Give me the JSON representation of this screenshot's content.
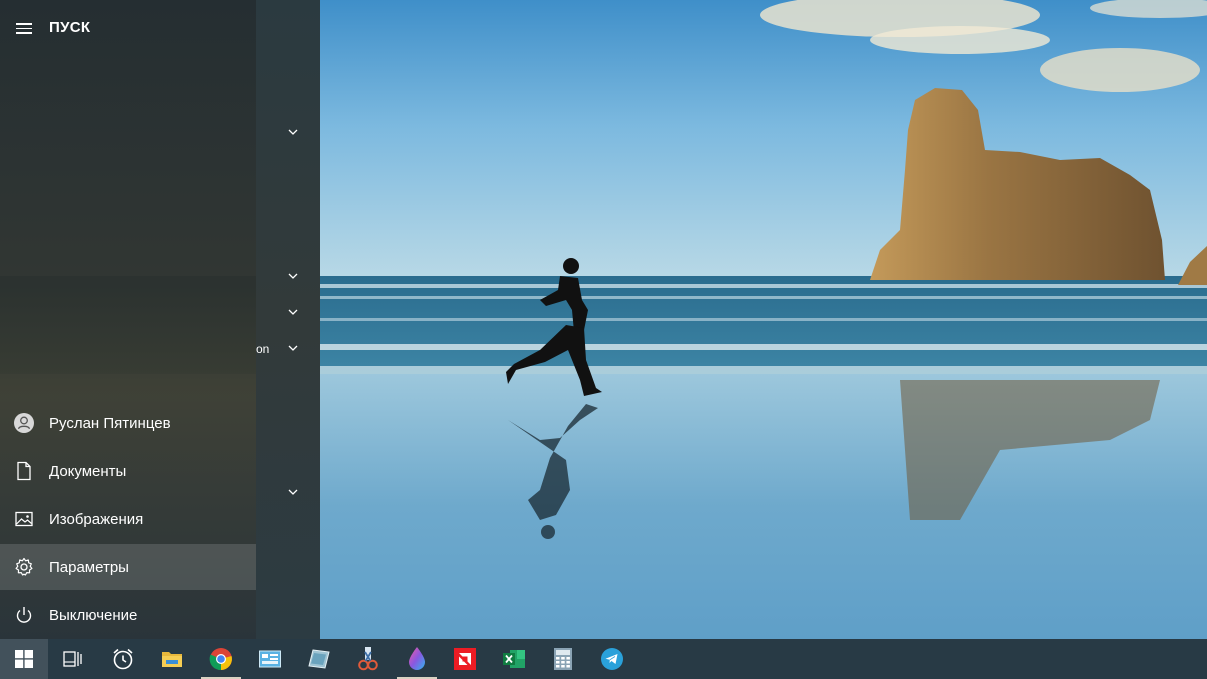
{
  "start_menu": {
    "title": "ПУСК",
    "rail_items": [
      {
        "label": "Руслан Пятинцев",
        "icon": "user-avatar-icon"
      },
      {
        "label": "Документы",
        "icon": "document-icon"
      },
      {
        "label": "Изображения",
        "icon": "pictures-icon"
      },
      {
        "label": "Параметры",
        "icon": "gear-icon",
        "active": true
      },
      {
        "label": "Выключение",
        "icon": "power-icon"
      }
    ],
    "app_list": {
      "partial_label": "on",
      "group_chevrons": [
        "chevron-down-icon",
        "chevron-down-icon",
        "chevron-down-icon",
        "chevron-down-icon",
        "chevron-down-icon"
      ]
    }
  },
  "taskbar": {
    "buttons": [
      {
        "name": "start-button",
        "icon": "windows-logo-icon"
      },
      {
        "name": "task-view-button",
        "icon": "task-view-icon"
      },
      {
        "name": "alarms-clock-button",
        "icon": "alarm-clock-icon"
      },
      {
        "name": "file-explorer-button",
        "icon": "folder-icon"
      },
      {
        "name": "chrome-button",
        "icon": "chrome-icon",
        "running": true
      },
      {
        "name": "control-panel-button",
        "icon": "control-panel-icon"
      },
      {
        "name": "app-tablet-button",
        "icon": "tablet-icon"
      },
      {
        "name": "snipping-tool-button",
        "icon": "scissors-icon"
      },
      {
        "name": "paint-drop-button",
        "icon": "color-drop-icon",
        "running": true
      },
      {
        "name": "amd-software-button",
        "icon": "amd-icon"
      },
      {
        "name": "excel-button",
        "icon": "excel-icon"
      },
      {
        "name": "calculator-button",
        "icon": "calculator-icon"
      },
      {
        "name": "telegram-button",
        "icon": "telegram-icon"
      }
    ]
  },
  "colors": {
    "taskbar": "#283a45",
    "menu_rail": "#2c3032",
    "accent_running": "#d9d2c2"
  }
}
